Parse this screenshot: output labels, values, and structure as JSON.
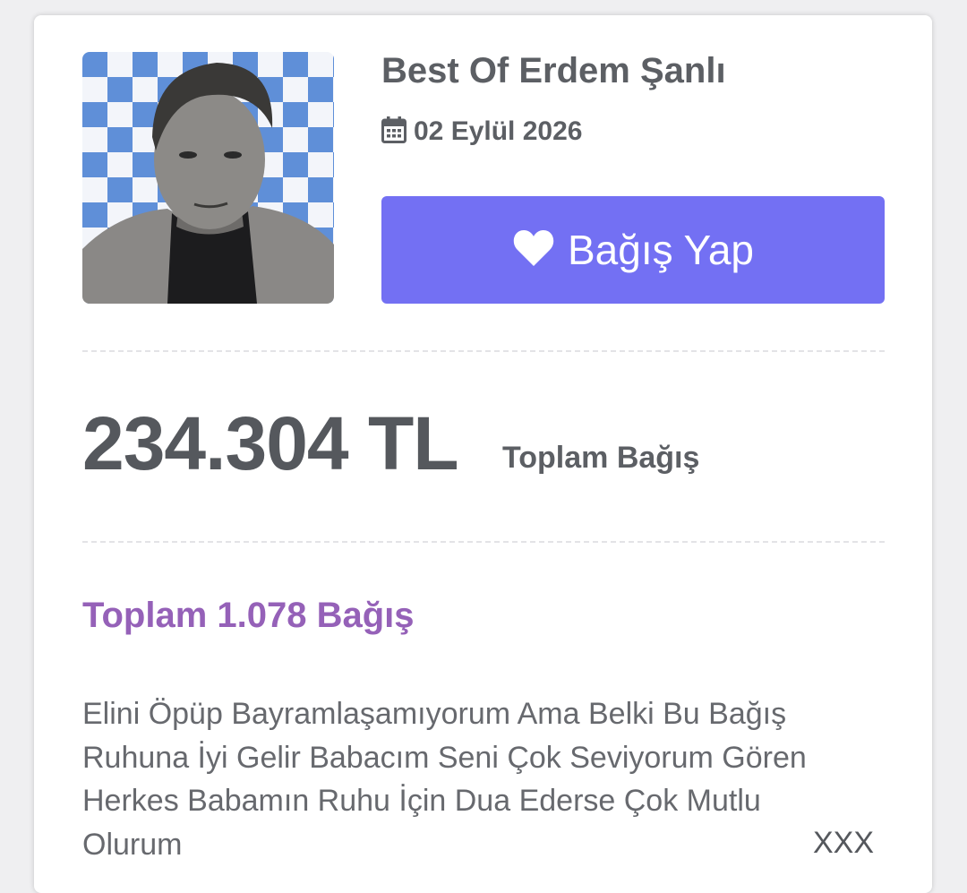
{
  "campaign": {
    "title": "Best Of Erdem Şanlı",
    "date": "02 Eylül 2026",
    "avatar_alt": "artist-photo"
  },
  "donate_button": {
    "label": "Bağış Yap",
    "icon": "heart-icon",
    "color": "#7370f3"
  },
  "summary": {
    "total_amount": "234.304 TL",
    "total_label": "Toplam Bağış",
    "count_label": "Toplam 1.078 Bağış"
  },
  "donation_message": {
    "text": "Elini Öpüp Bayramlaşamıyorum Ama Belki Bu Bağış Ruhuna İyi Gelir Babacım Seni Çok Seviyorum Gören Herkes Babamın Ruhu İçin Dua Ederse Çok Mutlu Olurum",
    "signature": "XXX"
  },
  "colors": {
    "accent": "#7370f3",
    "count_label": "#9561b8",
    "text": "#5c5f64"
  }
}
